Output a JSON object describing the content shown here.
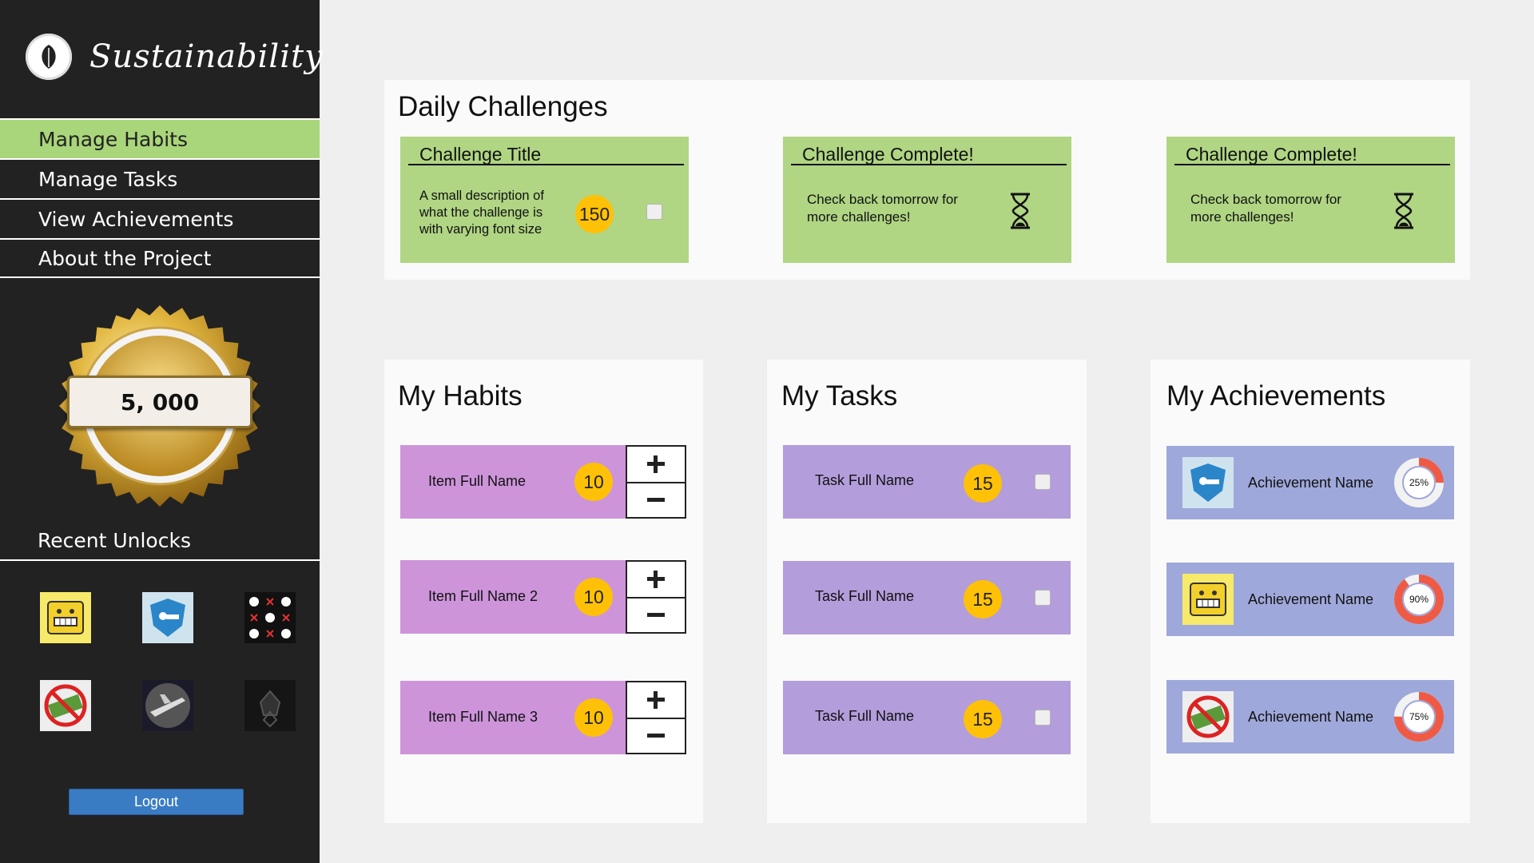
{
  "app": {
    "title": "Sustainability"
  },
  "sidebar": {
    "nav": [
      {
        "label": "Manage Habits",
        "active": true
      },
      {
        "label": "Manage Tasks"
      },
      {
        "label": "View Achievements"
      },
      {
        "label": "About the Project"
      }
    ],
    "points": "5, 000",
    "recent_unlocks_title": "Recent Unlocks",
    "recent_unlocks": [
      {
        "icon": "grimace-face-icon"
      },
      {
        "icon": "shield-car-icon"
      },
      {
        "icon": "skulls-pattern-icon"
      },
      {
        "icon": "no-money-icon"
      },
      {
        "icon": "airplane-icon"
      },
      {
        "icon": "dark-emblem-icon"
      }
    ],
    "logout_label": "Logout"
  },
  "daily_challenges": {
    "title": "Daily Challenges",
    "cards": [
      {
        "title": "Challenge Title",
        "description": "A small description of what the challenge is with varying font size",
        "points": "150",
        "checked": false
      },
      {
        "title": "Challenge Complete!",
        "message": "Check back tomorrow for more challenges!"
      },
      {
        "title": "Challenge Complete!",
        "message": "Check back tomorrow for more challenges!"
      }
    ]
  },
  "my_habits": {
    "title": "My Habits",
    "items": [
      {
        "name": "Item Full Name",
        "points": "10"
      },
      {
        "name": "Item Full Name 2",
        "points": "10"
      },
      {
        "name": "Item Full Name 3",
        "points": "10"
      }
    ]
  },
  "my_tasks": {
    "title": "My Tasks",
    "items": [
      {
        "name": "Task Full Name",
        "points": "15",
        "checked": false
      },
      {
        "name": "Task Full Name",
        "points": "15",
        "checked": false
      },
      {
        "name": "Task Full Name",
        "points": "15",
        "checked": false
      }
    ]
  },
  "my_achievements": {
    "title": "My Achievements",
    "items": [
      {
        "name": "Achievement Name",
        "progress": 25,
        "progress_label": "25%",
        "icon": "shield-car-icon"
      },
      {
        "name": "Achievement Name",
        "progress": 90,
        "progress_label": "90%",
        "icon": "grimace-face-icon"
      },
      {
        "name": "Achievement Name",
        "progress": 75,
        "progress_label": "75%",
        "icon": "no-money-icon"
      }
    ]
  },
  "colors": {
    "sidebar_bg": "#222222",
    "nav_active": "#a9d67a",
    "challenge_card": "#b0d583",
    "habit_row": "#cd94da",
    "task_row": "#b39ddb",
    "achievement_row": "#9fa8da",
    "coin": "#ffc107",
    "progress_ring": "#ef5a45",
    "logout_button": "#3a7cc4"
  }
}
